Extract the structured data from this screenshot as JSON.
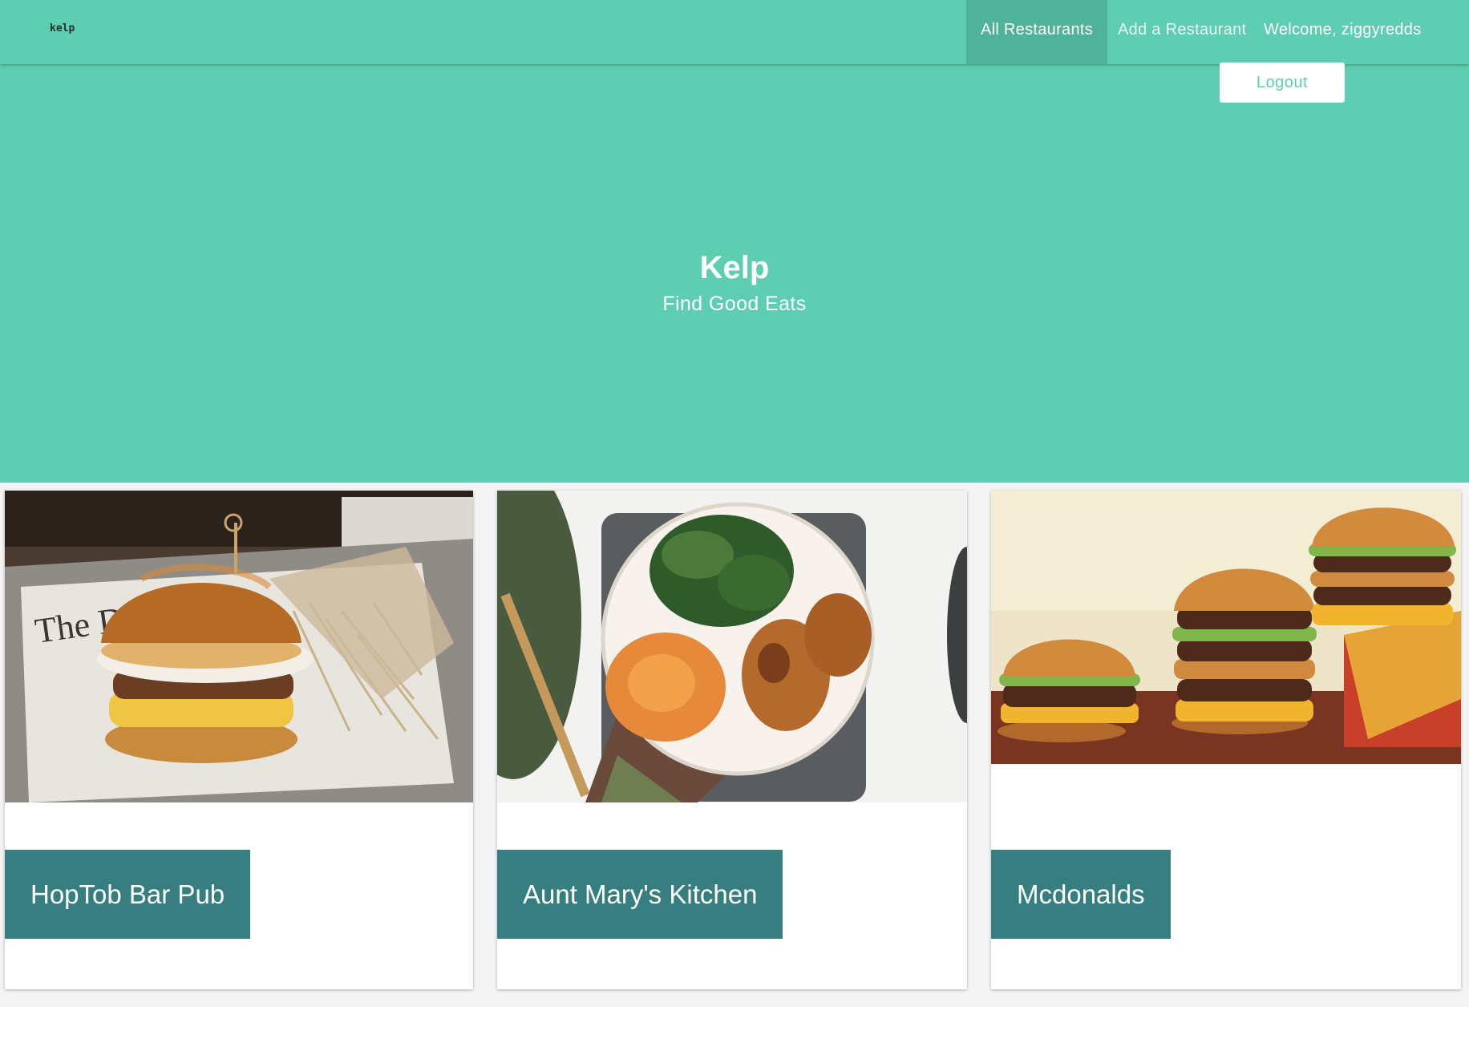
{
  "nav": {
    "brand": "kelp",
    "links": {
      "all_restaurants": "All Restaurants",
      "add_restaurant": "Add a Restaurant"
    },
    "welcome": "Welcome, ziggyredds",
    "logout": "Logout"
  },
  "hero": {
    "title": "Kelp",
    "subtitle": "Find Good Eats"
  },
  "restaurants": [
    {
      "name": "HopTob Bar Pub",
      "image": "burger-and-fries-photo"
    },
    {
      "name": "Aunt Mary's Kitchen",
      "image": "chicken-greens-plate-photo"
    },
    {
      "name": "Mcdonalds",
      "image": "three-burgers-photo"
    }
  ],
  "colors": {
    "primary": "#5dceb1",
    "nav_active": "#4fb39a",
    "card_label": "#367e7f",
    "page_bg": "#f4f4f4"
  }
}
